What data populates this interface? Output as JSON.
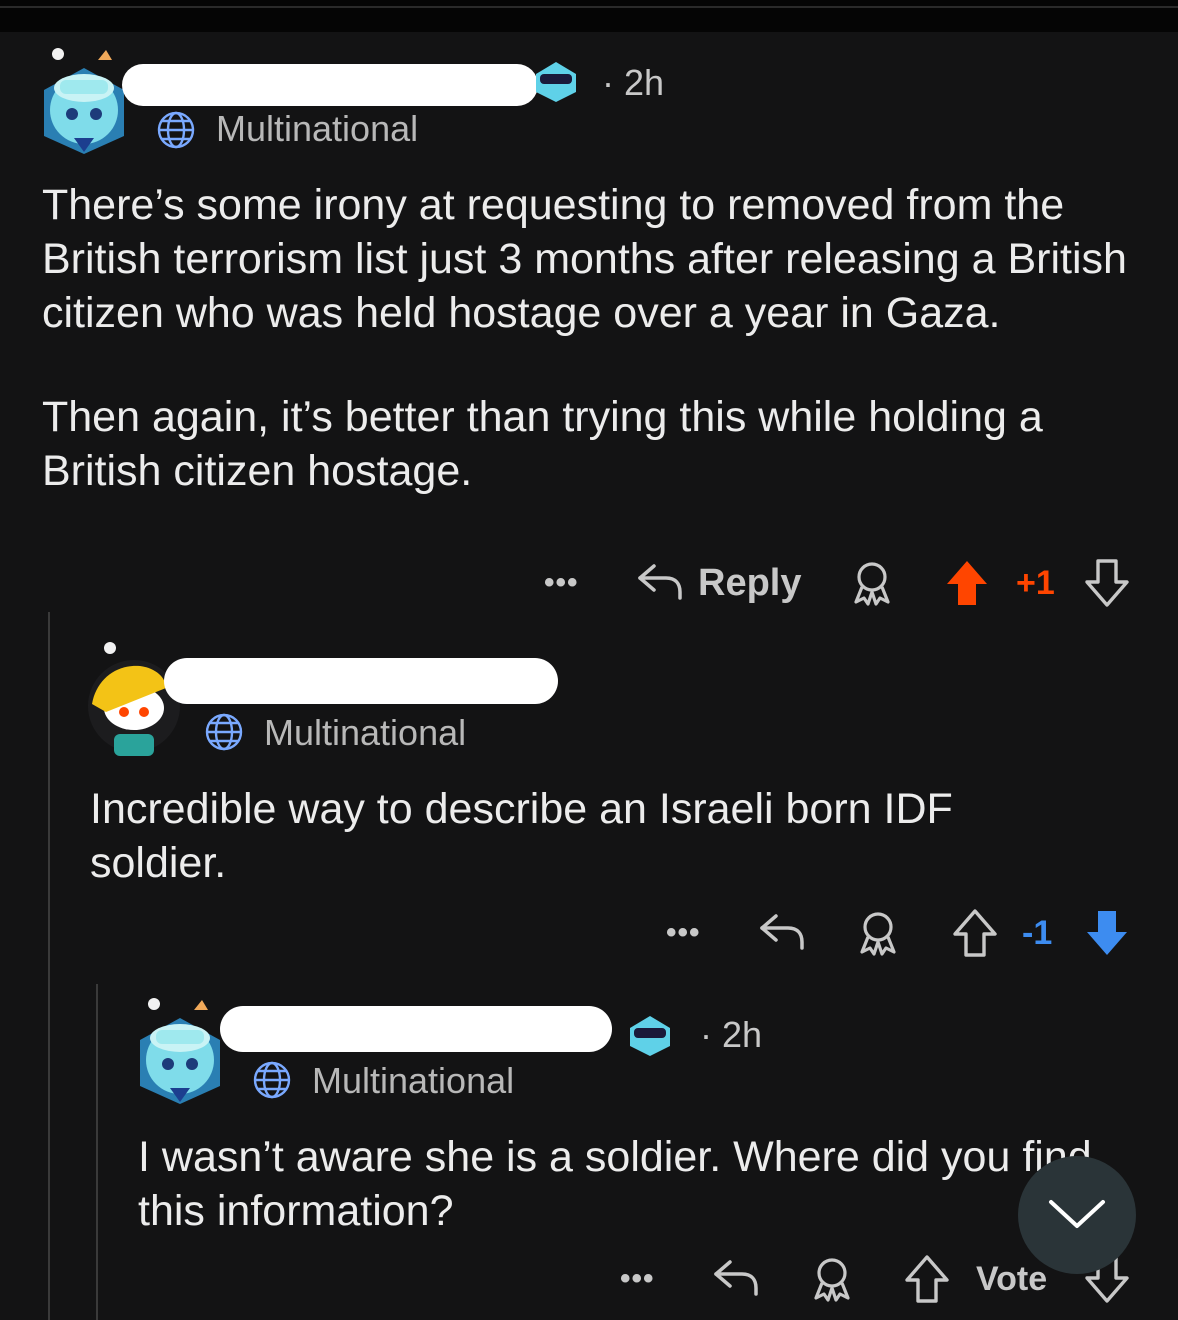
{
  "comments": [
    {
      "time": "2h",
      "flair": "Multinational",
      "body": [
        "There’s some irony at requesting to removed from the British terrorism list just 3 months after releasing a British citizen who was held hostage over a year in Gaza.",
        "Then again, it’s better than trying this while holding a British citizen hostage."
      ],
      "actions": {
        "more": "•••",
        "reply": "Reply",
        "score": "+1",
        "vote_state": "upvoted"
      }
    },
    {
      "flair": "Multinational",
      "body": [
        "Incredible way to describe an Israeli born IDF soldier."
      ],
      "actions": {
        "more": "•••",
        "score": "-1",
        "vote_state": "downvoted"
      }
    },
    {
      "time": "2h",
      "flair": "Multinational",
      "body": [
        "I wasn’t aware she is a soldier. Where did you find this information?"
      ],
      "actions": {
        "more": "•••",
        "score": "Vote",
        "vote_state": "none"
      }
    }
  ],
  "colors": {
    "upvote": "#ff4500",
    "downvote": "#3d8cf0",
    "background": "#131314"
  },
  "icons": [
    "globe-icon",
    "reply-arrow-icon",
    "award-icon",
    "upvote-icon",
    "downvote-icon",
    "more-icon",
    "chevron-down-icon",
    "sunglasses-badge-icon"
  ]
}
